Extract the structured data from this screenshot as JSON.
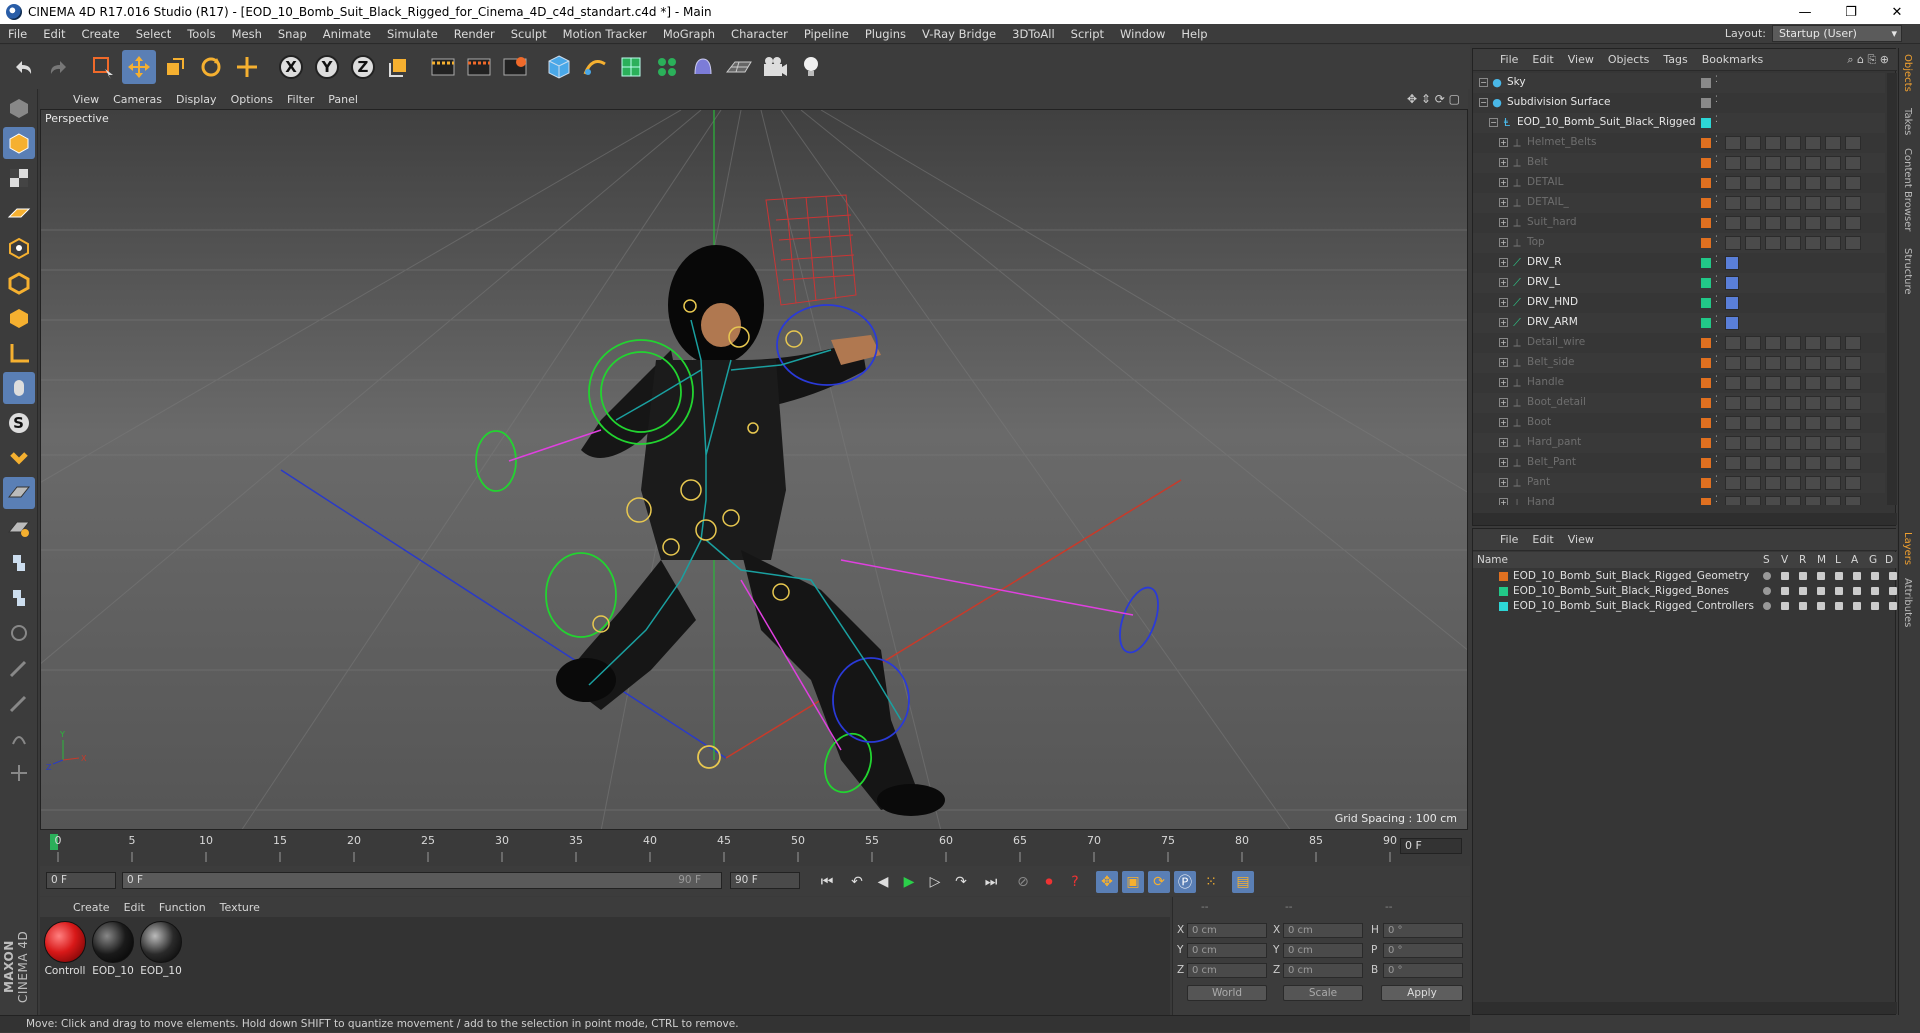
{
  "window": {
    "title": "CINEMA 4D R17.016 Studio (R17) - [EOD_10_Bomb_Suit_Black_Rigged_for_Cinema_4D_c4d_standart.c4d *] - Main",
    "controls": [
      "—",
      "❐",
      "✕"
    ]
  },
  "menubar": {
    "items": [
      "File",
      "Edit",
      "Create",
      "Select",
      "Tools",
      "Mesh",
      "Snap",
      "Animate",
      "Simulate",
      "Render",
      "Sculpt",
      "Motion Tracker",
      "MoGraph",
      "Character",
      "Pipeline",
      "Plugins",
      "V-Ray Bridge",
      "3DToAll",
      "Script",
      "Window",
      "Help"
    ],
    "layout_label": "Layout:",
    "layout_value": "Startup (User)"
  },
  "toolbar": {
    "icons": [
      "undo-icon",
      "redo-icon",
      "live-selection-icon",
      "move-icon",
      "scale-icon",
      "rotate-icon",
      "move-axis-icon",
      "x-axis-icon",
      "y-axis-icon",
      "z-axis-icon",
      "world-coordinates-icon",
      "render-view-icon",
      "render-picture-viewer-icon",
      "render-settings-icon",
      "cube-primitive-icon",
      "pen-spline-icon",
      "subdivision-nurbs-icon",
      "cloner-icon",
      "deformer-icon",
      "floor-scene-icon",
      "camera-icon",
      "light-icon"
    ],
    "axis_labels": [
      "X",
      "Y",
      "Z"
    ]
  },
  "left_toolbar": {
    "icons": [
      "make-editable-icon",
      "model-mode-icon",
      "texture-mode-icon",
      "workplane-mode-icon",
      "points-mode-icon",
      "edges-mode-icon",
      "polygons-mode-icon",
      "axis-mode-icon",
      "tweak-mode-icon",
      "solo-icon",
      "magnet-icon",
      "snap-grid-icon",
      "snap-lock-icon",
      "python-icon",
      "python-icon-2",
      "paint-icon",
      "sketch-icon",
      "brush-icon",
      "sculpt-icon",
      "misc-tool-icon"
    ],
    "solo_letter": "S",
    "brand_top": "MAXON",
    "brand_bottom": "CINEMA 4D"
  },
  "viewport": {
    "menu": [
      "View",
      "Cameras",
      "Display",
      "Options",
      "Filter",
      "Panel"
    ],
    "label": "Perspective",
    "grid_spacing": "Grid Spacing : 100 cm",
    "axis_labels": [
      "Y",
      "X",
      "Z"
    ]
  },
  "timeline": {
    "ticks": [
      "0",
      "5",
      "10",
      "15",
      "20",
      "25",
      "30",
      "35",
      "40",
      "45",
      "50",
      "55",
      "60",
      "65",
      "70",
      "75",
      "80",
      "85",
      "90"
    ],
    "current_frame": "0 F"
  },
  "transport": {
    "start_frame": "0 F",
    "range_start": "0 F",
    "range_end": "90 F",
    "end_frame": "90 F"
  },
  "material_manager": {
    "menu": [
      "Create",
      "Edit",
      "Function",
      "Texture"
    ],
    "materials": [
      {
        "label": "Controll",
        "color": "#d81818"
      },
      {
        "label": "EOD_10",
        "color": "#1a1a1a"
      },
      {
        "label": "EOD_10",
        "color": "#2a2a2a"
      }
    ]
  },
  "coordinates": {
    "headers": [
      "--",
      "--",
      "--"
    ],
    "rows": [
      {
        "a_label": "X",
        "a_value": "0 cm",
        "b_label": "X",
        "b_value": "0 cm",
        "c_label": "H",
        "c_value": "0 °"
      },
      {
        "a_label": "Y",
        "a_value": "0 cm",
        "b_label": "Y",
        "b_value": "0 cm",
        "c_label": "P",
        "c_value": "0 °"
      },
      {
        "a_label": "Z",
        "a_value": "0 cm",
        "b_label": "Z",
        "b_value": "0 cm",
        "c_label": "B",
        "c_value": "0 °"
      }
    ],
    "world_select": "World",
    "scale_select": "Scale",
    "apply_label": "Apply"
  },
  "statusbar": {
    "text": "Move: Click and drag to move elements. Hold down SHIFT to quantize movement / add to the selection in point mode, CTRL to remove."
  },
  "object_manager": {
    "menu": [
      "File",
      "Edit",
      "View",
      "Objects",
      "Tags",
      "Bookmarks"
    ],
    "objects": [
      {
        "name": "Sky",
        "level": 0,
        "dim": false,
        "color": "#8a8a8a"
      },
      {
        "name": "Subdivision Surface",
        "level": 0,
        "dim": false,
        "color": "#8a8a8a"
      },
      {
        "name": "EOD_10_Bomb_Suit_Black_Rigged",
        "level": 1,
        "dim": false,
        "color": "#2dd6d6"
      },
      {
        "name": "Helmet_Belts",
        "level": 2,
        "dim": true,
        "color": "#e07020"
      },
      {
        "name": "Belt",
        "level": 2,
        "dim": true,
        "color": "#e07020"
      },
      {
        "name": "DETAIL",
        "level": 2,
        "dim": true,
        "color": "#e07020"
      },
      {
        "name": "DETAIL_",
        "level": 2,
        "dim": true,
        "color": "#e07020"
      },
      {
        "name": "Suit_hard",
        "level": 2,
        "dim": true,
        "color": "#e07020"
      },
      {
        "name": "Top",
        "level": 2,
        "dim": true,
        "color": "#e07020"
      },
      {
        "name": "DRV_R",
        "level": 2,
        "dim": false,
        "color": "#22c888"
      },
      {
        "name": "DRV_L",
        "level": 2,
        "dim": false,
        "color": "#22c888"
      },
      {
        "name": "DRV_HND",
        "level": 2,
        "dim": false,
        "color": "#22c888"
      },
      {
        "name": "DRV_ARM",
        "level": 2,
        "dim": false,
        "color": "#22c888"
      },
      {
        "name": "Detail_wire",
        "level": 2,
        "dim": true,
        "color": "#e07020"
      },
      {
        "name": "Belt_side",
        "level": 2,
        "dim": true,
        "color": "#e07020"
      },
      {
        "name": "Handle",
        "level": 2,
        "dim": true,
        "color": "#e07020"
      },
      {
        "name": "Boot_detail",
        "level": 2,
        "dim": true,
        "color": "#e07020"
      },
      {
        "name": "Boot",
        "level": 2,
        "dim": true,
        "color": "#e07020"
      },
      {
        "name": "Hard_pant",
        "level": 2,
        "dim": true,
        "color": "#e07020"
      },
      {
        "name": "Belt_Pant",
        "level": 2,
        "dim": true,
        "color": "#e07020"
      },
      {
        "name": "Pant",
        "level": 2,
        "dim": true,
        "color": "#e07020"
      },
      {
        "name": "Hand",
        "level": 2,
        "dim": true,
        "color": "#e07020"
      }
    ]
  },
  "layer_manager": {
    "menu": [
      "File",
      "Edit",
      "View"
    ],
    "columns": [
      "Name",
      "S",
      "V",
      "R",
      "M",
      "L",
      "A",
      "G",
      "D"
    ],
    "layers": [
      {
        "name": "EOD_10_Bomb_Suit_Black_Rigged_Geometry",
        "color": "#e07020"
      },
      {
        "name": "EOD_10_Bomb_Suit_Black_Rigged_Bones",
        "color": "#22c888"
      },
      {
        "name": "EOD_10_Bomb_Suit_Black_Rigged_Controllers",
        "color": "#2dd6d6"
      }
    ]
  },
  "side_tabs": {
    "top": [
      "Objects",
      "Takes",
      "Content Browser",
      "Structure"
    ],
    "bottom": [
      "Layers",
      "Attributes"
    ]
  },
  "colors": {
    "accent": "#5a7fb5",
    "panel_bg": "#3c3c3c",
    "orange": "#f0a030"
  }
}
